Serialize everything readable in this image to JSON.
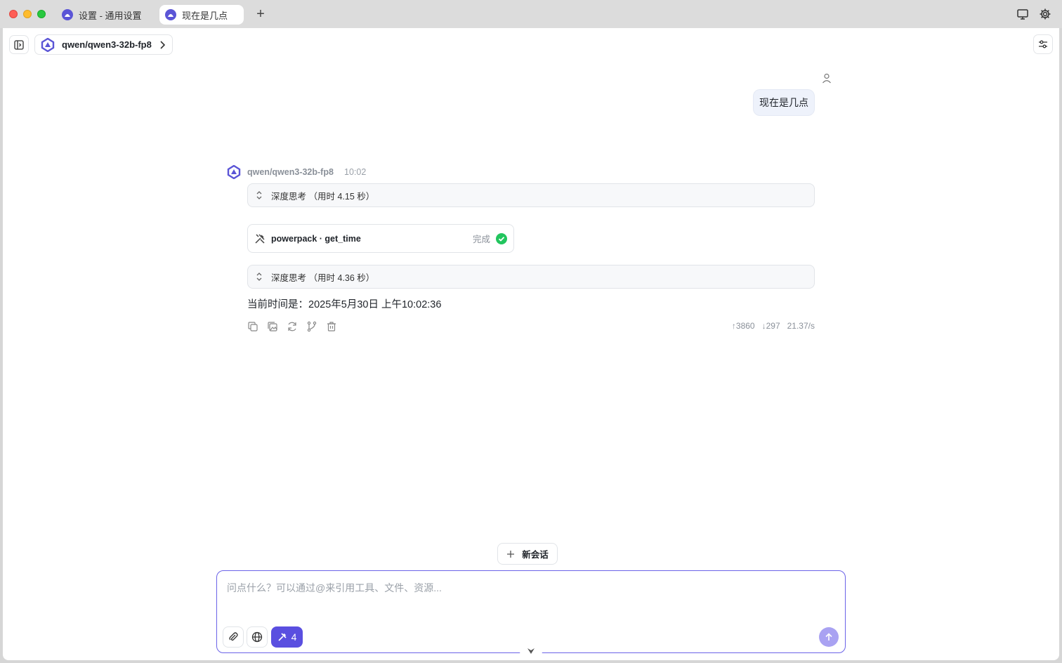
{
  "tabs": [
    {
      "label": "设置 - 通用设置"
    },
    {
      "label": "现在是几点"
    }
  ],
  "header": {
    "model_name": "qwen/qwen3-32b-fp8"
  },
  "user_message": {
    "text": "现在是几点"
  },
  "assistant": {
    "model_name": "qwen/qwen3-32b-fp8",
    "time": "10:02",
    "think1": "深度思考 （用时 4.15 秒）",
    "tool_name": "powerpack · get_time",
    "tool_status": "完成",
    "think2": "深度思考 （用时 4.36 秒）",
    "answer": "当前时间是：2025年5月30日 上午10:02:36",
    "stats": {
      "tokens_up": "↑3860",
      "tokens_down": "↓297",
      "speed": "21.37/s"
    }
  },
  "new_chat_label": "新会话",
  "composer": {
    "placeholder": "问点什么？可以通过@来引用工具、文件、资源...",
    "tools_count": "4"
  },
  "colors": {
    "accent": "#5a4fe0",
    "send_disabled": "#a9a2f2",
    "success": "#22c55e"
  }
}
